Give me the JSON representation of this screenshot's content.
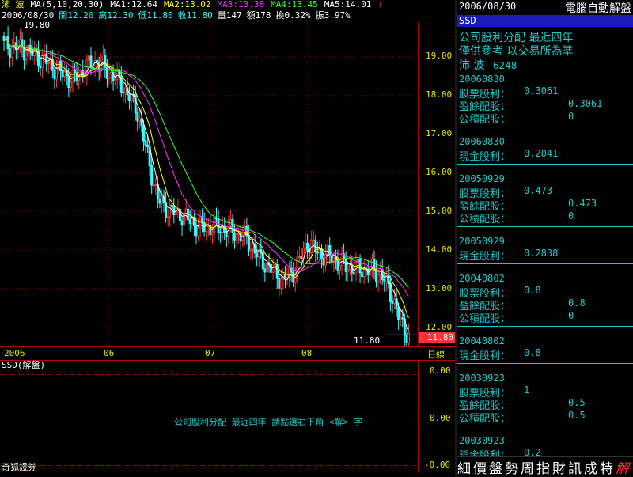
{
  "header": {
    "stock_name": "沛 波",
    "ma_spec": "MA(5,10,20,30)",
    "ma1": "MA1:12.64",
    "ma2": "MA2:13.02",
    "ma3": "MA3:13.38",
    "ma4": "MA4:13.45",
    "ma5": "MA5:14.01",
    "date": "2006/08/30",
    "open": "開12.20",
    "high": "高12.30",
    "low": "低11.80",
    "close": "收11.80",
    "volume": "量147",
    "amount": "額178",
    "turnover": "換0.32%",
    "amplitude": "振3.97%",
    "arrow": "↓",
    "colors": {
      "ma1": "#ffffff",
      "ma2": "#ffff00",
      "ma3": "#ff33ff",
      "ma4": "#33ff33",
      "ma5": "#ffffff"
    }
  },
  "chart": {
    "price_axis_labels": [
      "19.00",
      "18.00",
      "17.00",
      "16.00",
      "15.00",
      "14.00",
      "13.00",
      "12.00"
    ],
    "top_left_marker": "19.80",
    "last_price": "11.80",
    "last_price_tag": "11.80",
    "x_labels": [
      "2006",
      "06",
      "07",
      "08"
    ],
    "period_label": "日線",
    "colors": {
      "up": "#ff3333",
      "down": "#33ffff",
      "ma5": "#ffffff",
      "ma10": "#ffff00",
      "ma20": "#ff33ff",
      "ma30": "#33ff33"
    }
  },
  "sub_panel": {
    "title": "SSD(解盤)",
    "axis_labels": [
      "0.00",
      "0.00",
      "-0.00"
    ],
    "hint": "公司股利分配  最近四年    請點選右下角 <解> 字",
    "broker": "奇狐證券"
  },
  "right_panel": {
    "date": "2006/08/30",
    "mode": "電腦自動解盤",
    "ssd": "SSD",
    "heading1": "公司股利分配  最近四年",
    "heading2": "僅供參考  以交易所為準",
    "stock_name": "沛  波",
    "stock_code": "6248",
    "sections": [
      {
        "date": "20060830",
        "rows": [
          {
            "label": "股票股利：",
            "value": "0.3061"
          },
          {
            "label": "盈餘配股：",
            "value": "0.3061"
          },
          {
            "label": "公積配股：",
            "value": "0"
          }
        ]
      },
      {
        "date": "20060830",
        "rows": [
          {
            "label": "現金股利：",
            "value": "0.2041"
          }
        ]
      },
      {
        "date": "20050929",
        "rows": [
          {
            "label": "股票股利：",
            "value": "0.473"
          },
          {
            "label": "盈餘配股：",
            "value": "0.473"
          },
          {
            "label": "公積配股：",
            "value": "0"
          }
        ]
      },
      {
        "date": "20050929",
        "rows": [
          {
            "label": "現金股利：",
            "value": "0.2838"
          }
        ]
      },
      {
        "date": "20040802",
        "rows": [
          {
            "label": "股票股利：",
            "value": "0.8"
          },
          {
            "label": "盈餘配股：",
            "value": "0.8"
          },
          {
            "label": "公積配股：",
            "value": "0"
          }
        ]
      },
      {
        "date": "20040802",
        "rows": [
          {
            "label": "現金股利：",
            "value": "0.8"
          }
        ]
      },
      {
        "date": "20030923",
        "rows": [
          {
            "label": "股票股利：",
            "value": "1"
          },
          {
            "label": "盈餘配股：",
            "value": "0.5"
          },
          {
            "label": "公積配股：",
            "value": "0.5"
          }
        ]
      },
      {
        "date": "20030923",
        "rows": [
          {
            "label": "現金股利：",
            "value": "0.2"
          }
        ]
      }
    ],
    "bottom_menu": [
      "細",
      "價",
      "盤",
      "勢",
      "周",
      "指",
      "財",
      "訊",
      "成",
      "特",
      "解"
    ]
  }
}
